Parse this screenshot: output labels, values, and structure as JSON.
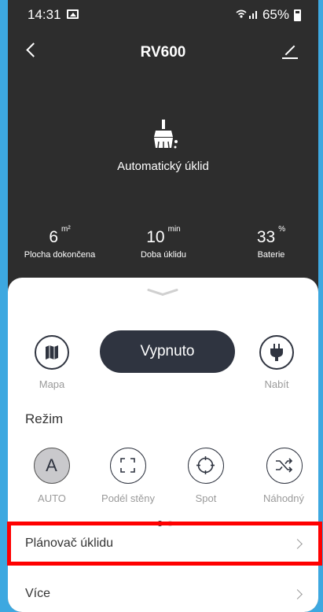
{
  "status": {
    "time": "14:31",
    "battery_text": "65%"
  },
  "header": {
    "title": "RV600"
  },
  "mode": {
    "label": "Automatický úklid"
  },
  "stats": [
    {
      "value": "6",
      "unit": "m²",
      "label": "Plocha dokončena"
    },
    {
      "value": "10",
      "unit": "min",
      "label": "Doba úklidu"
    },
    {
      "value": "33",
      "unit": "%",
      "label": "Baterie"
    }
  ],
  "controls": {
    "map_label": "Mapa",
    "power_label": "Vypnuto",
    "charge_label": "Nabít"
  },
  "regime": {
    "title": "Režim",
    "modes": [
      {
        "label": "AUTO",
        "icon": "auto-icon",
        "active": true
      },
      {
        "label": "Podél stěny",
        "icon": "wall-follow-icon",
        "active": false
      },
      {
        "label": "Spot",
        "icon": "spot-icon",
        "active": false
      },
      {
        "label": "Náhodný",
        "icon": "random-icon",
        "active": false
      }
    ],
    "page_indicator": {
      "current": 1,
      "total": 2
    }
  },
  "menu": {
    "scheduler_label": "Plánovač úklidu",
    "more_label": "Více"
  },
  "colors": {
    "frame": "#3da8e0",
    "dark": "#2f3440",
    "highlight": "#ff0000"
  }
}
